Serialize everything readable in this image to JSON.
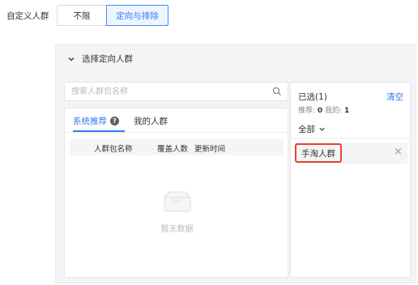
{
  "row_label": "自定义人群",
  "segments": {
    "unlimited": "不限",
    "target_exclude": "定向与排除"
  },
  "panel": {
    "header": "选择定向人群",
    "search": {
      "placeholder": "搜索人群包名称",
      "value": ""
    },
    "tabs": {
      "recommended": "系统推荐",
      "mine": "我的人群",
      "active": "系统推荐"
    },
    "table_headers": [
      "人群包名称",
      "覆盖人数",
      "更新时间"
    ],
    "empty_text": "暂无数据",
    "selected": {
      "title": "已选(1)",
      "clear_label": "清空",
      "recommend_label": "推荐:",
      "recommend_count": "0",
      "mine_label": "我的:",
      "mine_count": "1",
      "filter_label": "全部",
      "items": [
        {
          "name": "手淘人群"
        }
      ]
    }
  },
  "colors": {
    "accent": "#2f7cf6",
    "highlight": "#e8432e",
    "panel_bg": "#f3f4f6"
  },
  "icons": [
    "chevron-down-icon",
    "search-icon",
    "help-icon",
    "empty-box-icon",
    "close-icon"
  ]
}
